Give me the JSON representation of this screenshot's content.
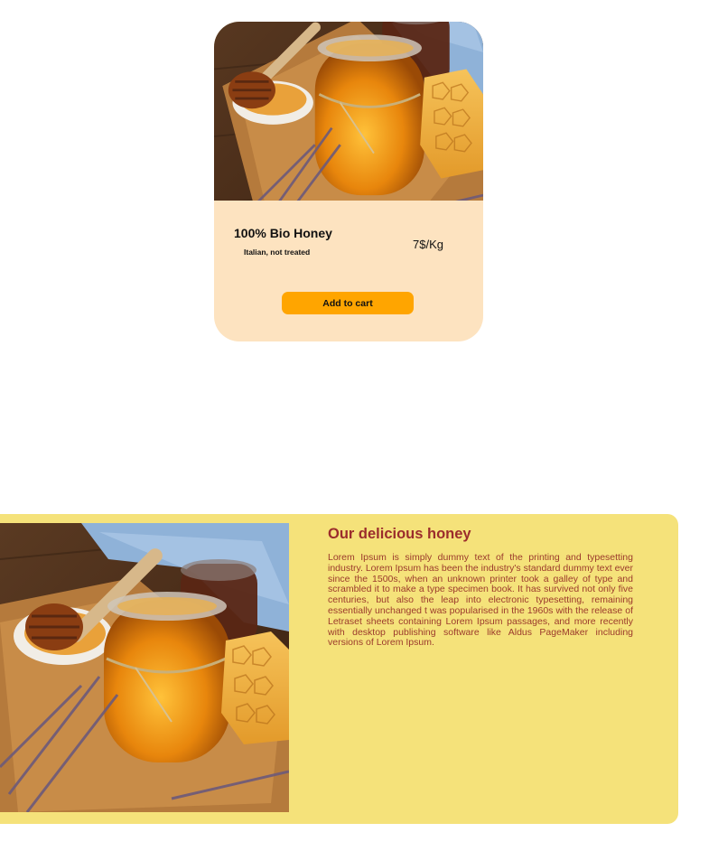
{
  "product_card": {
    "title": "100% Bio Honey",
    "subtitle": "Italian, not treated",
    "price": "7$/Kg",
    "add_to_cart_label": "Add to cart",
    "image_alt": "honey jar photo"
  },
  "feature": {
    "title": "Our delicious honey",
    "body": "Lorem Ipsum is simply dummy text of the printing and typesetting industry. Lorem Ipsum has been the industry's standard dummy text ever since the 1500s, when an unknown printer took a galley of type and scrambled it to make a type specimen book. It has survived not only five centuries, but also the leap into electronic typesetting, remaining essentially unchanged t was popularised in the 1960s with the release of Letraset sheets containing Lorem Ipsum passages, and more recently with desktop publishing software like Aldus PageMaker including versions of Lorem Ipsum."
  },
  "colors": {
    "card_background": "#fde3c0",
    "button": "#ffa500",
    "feature_background": "#f5e27a",
    "feature_text": "#9b2c2c"
  }
}
